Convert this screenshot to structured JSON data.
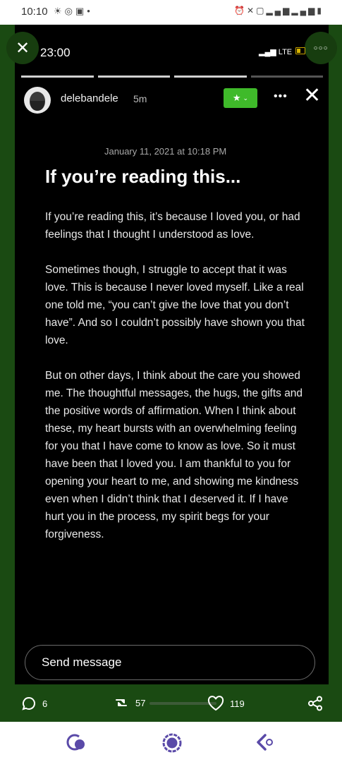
{
  "status_bar": {
    "time": "10:10",
    "left_icons": [
      "sunrise-icon",
      "instagram-icon",
      "gallery-icon",
      "dot-icon"
    ],
    "right_icons": [
      "alarm-icon",
      "mute-icon",
      "lock-icon",
      "signal-icon",
      "signal-icon",
      "battery-icon"
    ]
  },
  "story": {
    "inner_time": "23:00",
    "network": "LTE",
    "progress": {
      "segments": 4,
      "viewed": 3
    },
    "header": {
      "username": "delebandele",
      "posted_ago": "5m"
    },
    "date": "January 11, 2021 at 10:18 PM",
    "title": "If you’re reading this...",
    "paragraphs": [
      "If you’re reading this, it’s because I loved you, or had feelings that I thought I understood as love.",
      "Sometimes though, I struggle to accept that it was love. This is because I never loved myself. Like a real one told me, “you can’t give the love that you don’t have”. And so I couldn’t possibly have shown you that love.",
      "But on other days, I think about the care you showed me. The thoughtful messages, the hugs, the gifts and the positive words of affirmation. When I think about these, my heart bursts with an overwhelming feeling for you that I have come to know as love. So it must have been that I loved you. I am thankful to you for opening your heart to me, and showing me kindness even when I didn’t think that I deserved it. If I have hurt you in the process, my spirit begs for your forgiveness."
    ],
    "reply_placeholder": "Send message",
    "actions": {
      "comments": "6",
      "restories": "57",
      "likes": "119"
    }
  },
  "colors": {
    "frame": "#1a4a12",
    "story_bg": "#000000",
    "accent_green": "#3fba2a"
  }
}
